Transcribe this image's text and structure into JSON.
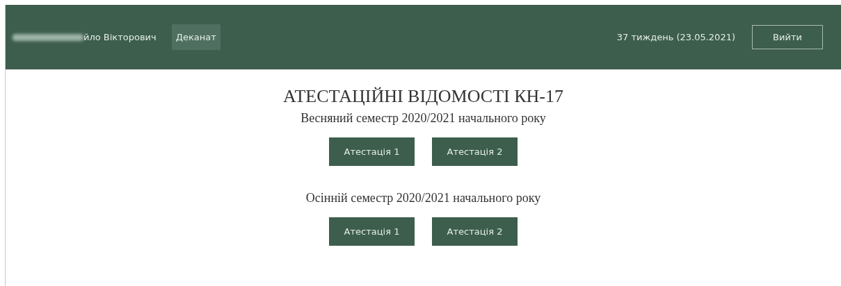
{
  "header": {
    "user_name": "йло Вікторович",
    "nav": [
      {
        "label": "Деканат",
        "selected": true
      }
    ],
    "week": "37 тиждень (23.05.2021)",
    "logout": "Вийти"
  },
  "title": "АТЕСТАЦІЙНІ ВІДОМОСТІ КН-17",
  "semesters": [
    {
      "label": "Весняний семестр 2020/2021 начального року",
      "buttons": [
        "Атестація 1",
        "Атестація 2"
      ]
    },
    {
      "label": "Осінній семестр 2020/2021 начального року",
      "buttons": [
        "Атестація 1",
        "Атестація 2"
      ]
    }
  ]
}
